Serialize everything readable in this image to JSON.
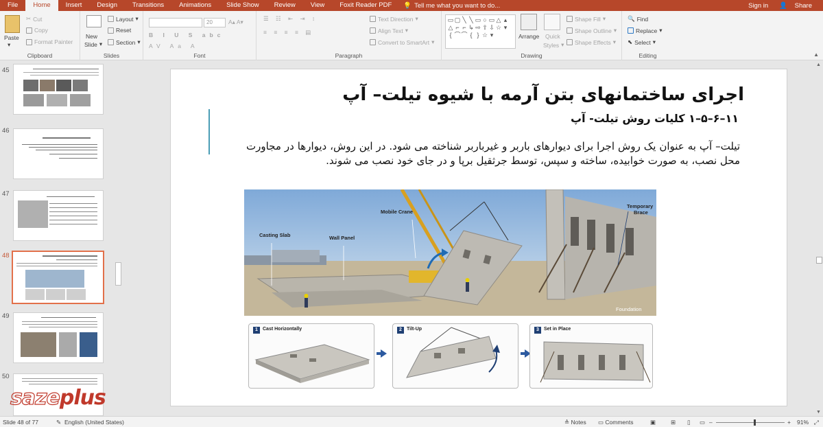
{
  "menubar": {
    "tabs": [
      "File",
      "Home",
      "Insert",
      "Design",
      "Transitions",
      "Animations",
      "Slide Show",
      "Review",
      "View",
      "Foxit Reader PDF"
    ],
    "active_tab": "Home",
    "tell_me": "Tell me what you want to do...",
    "sign_in": "Sign in",
    "share": "Share",
    "accent_color": "#b7472a"
  },
  "ribbon": {
    "clipboard": {
      "paste": "Paste",
      "cut": "Cut",
      "copy": "Copy",
      "format_painter": "Format Painter",
      "label": "Clipboard"
    },
    "slides": {
      "new_slide_1": "New",
      "new_slide_2": "Slide",
      "layout": "Layout",
      "reset": "Reset",
      "section": "Section",
      "label": "Slides"
    },
    "font": {
      "font_size": "20",
      "label": "Font"
    },
    "paragraph": {
      "text_direction": "Text Direction",
      "align_text": "Align Text",
      "convert_smartart": "Convert to SmartArt",
      "label": "Paragraph"
    },
    "drawing": {
      "arrange": "Arrange",
      "quick_1": "Quick",
      "quick_2": "Styles",
      "shape_fill": "Shape Fill",
      "shape_outline": "Shape Outline",
      "shape_effects": "Shape Effects",
      "label": "Drawing"
    },
    "editing": {
      "find": "Find",
      "replace": "Replace",
      "select": "Select",
      "label": "Editing"
    }
  },
  "thumbnails": {
    "items": [
      {
        "number": "45"
      },
      {
        "number": "46"
      },
      {
        "number": "47"
      },
      {
        "number": "48"
      },
      {
        "number": "49"
      },
      {
        "number": "50"
      }
    ],
    "selected": "48"
  },
  "slide": {
    "title": "اجرای ساختمانهای بتن آرمه با شیوه تیلت– آپ",
    "subtitle": "۱۱–۶–۵–۱ کلیات روش تیلت- آپ",
    "body": "تیلت– آپ به عنوان یک روش اجرا برای دیوارهای باربر و غیرباربر شناخته می شود. در این روش، دیوارها در مجاورت محل نصب، به صورت خوابیده، ساخته و سپس، توسط جرثقیل برپا و در جای خود نصب می شوند.",
    "photo_labels": {
      "casting_slab": "Casting Slab",
      "wall_panel": "Wall Panel",
      "mobile_crane": "Mobile Crane",
      "temporary_brace_1": "Temporary",
      "temporary_brace_2": "Brace",
      "foundation": "Foundation"
    },
    "steps": [
      {
        "number": "1",
        "label": "Cast Horizontally"
      },
      {
        "number": "2",
        "label": "Tilt-Up"
      },
      {
        "number": "3",
        "label": "Set in Place"
      }
    ]
  },
  "status": {
    "slide_info": "Slide 48 of 77",
    "language": "English (United States)",
    "notes": "Notes",
    "comments": "Comments",
    "zoom": "91%"
  },
  "logo": {
    "part1": "saze",
    "part2": "plus",
    "color": "#c0392b"
  }
}
